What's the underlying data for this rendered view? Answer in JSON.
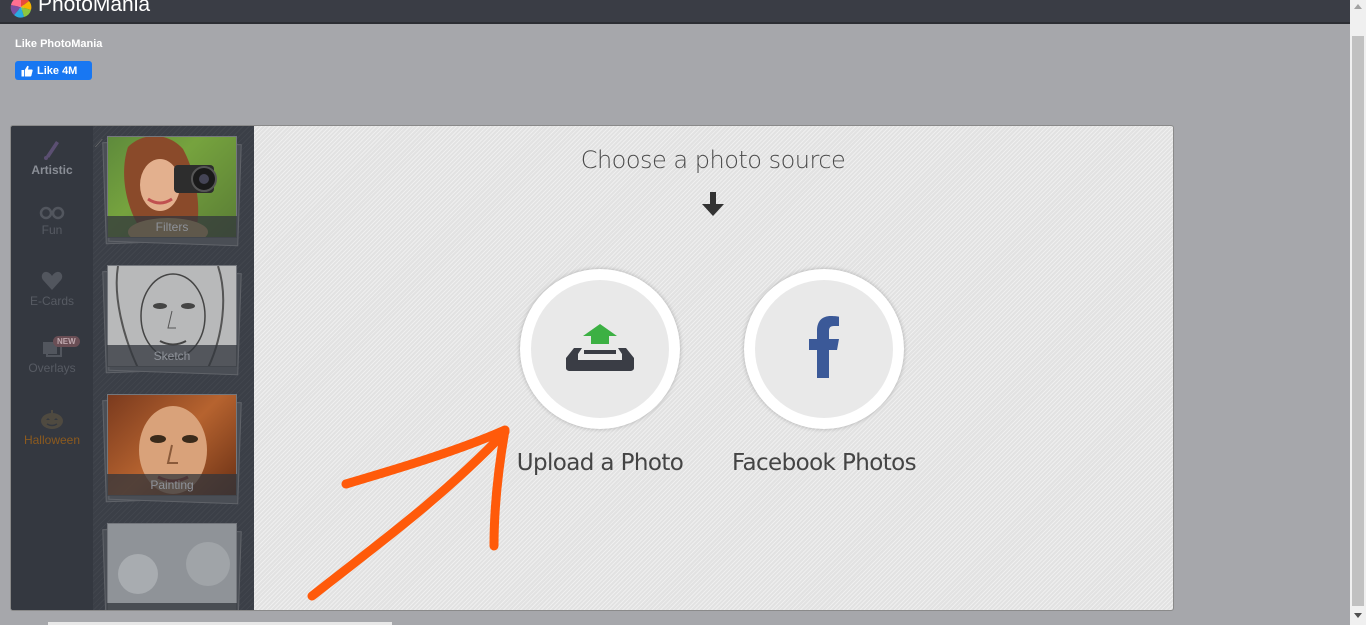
{
  "app": {
    "title": "PhotoMania"
  },
  "facebook_like": {
    "label": "Like PhotoMania",
    "button_label": "Like 4M"
  },
  "sidebar": {
    "categories": [
      {
        "label": "Artistic",
        "icon": "brush-icon",
        "active": true
      },
      {
        "label": "Fun",
        "icon": "glasses-icon"
      },
      {
        "label": "E-Cards",
        "icon": "heart-icon"
      },
      {
        "label": "Overlays",
        "icon": "overlays-icon",
        "badge": "NEW"
      },
      {
        "label": "Halloween",
        "icon": "pumpkin-icon"
      }
    ],
    "thumbnails": [
      {
        "label": "Filters"
      },
      {
        "label": "Sketch"
      },
      {
        "label": "Painting"
      },
      {
        "label": ""
      }
    ]
  },
  "main": {
    "heading": "Choose a photo source",
    "sources": [
      {
        "label": "Upload a Photo",
        "icon": "upload-icon"
      },
      {
        "label": "Facebook Photos",
        "icon": "facebook-icon"
      }
    ]
  },
  "colors": {
    "annotation_arrow": "#ff5a0a",
    "upload_arrow": "#3cb043",
    "facebook_blue": "#3b5998",
    "like_button": "#1877f2"
  }
}
